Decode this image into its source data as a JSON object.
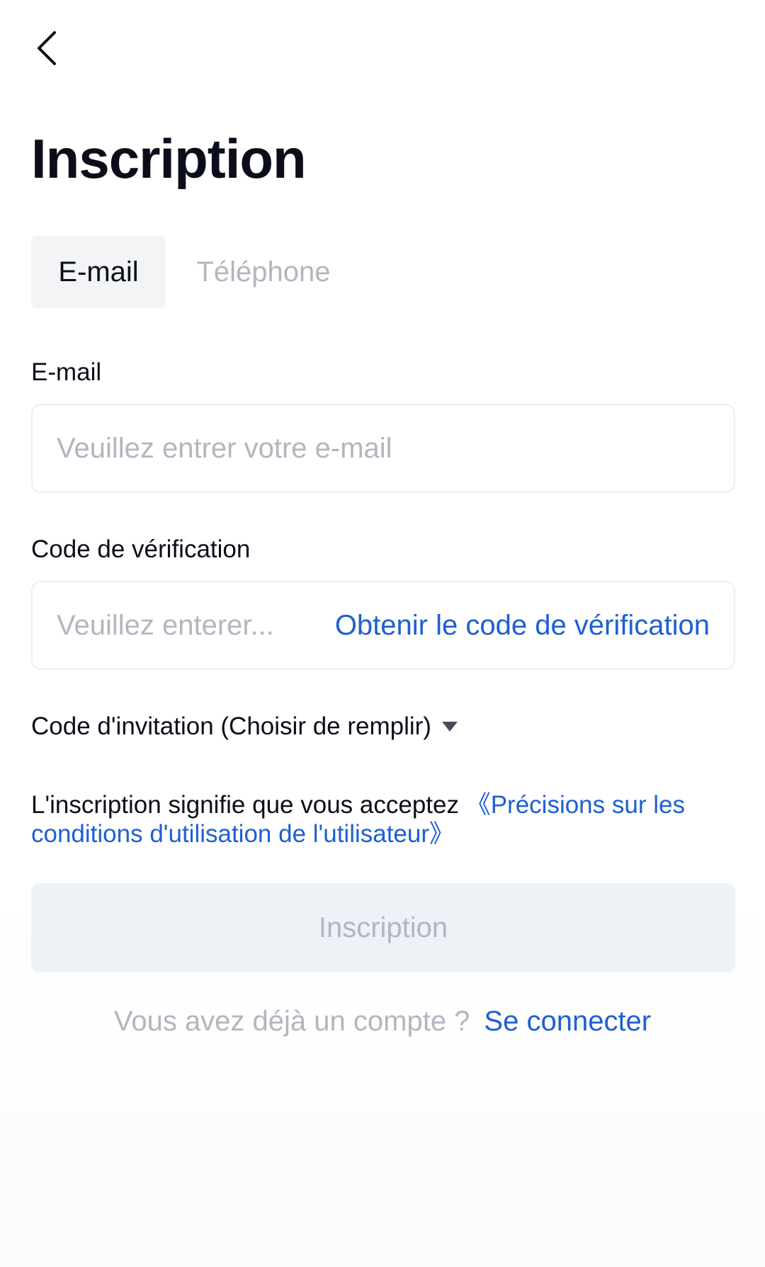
{
  "header": {
    "back_icon": "chevron-left-icon",
    "title": "Inscription"
  },
  "tabs": [
    {
      "label": "E-mail",
      "active": true
    },
    {
      "label": "Téléphone",
      "active": false
    }
  ],
  "email": {
    "label": "E-mail",
    "value": "",
    "placeholder": "Veuillez entrer votre e-mail"
  },
  "verification": {
    "label": "Code de vérification",
    "value": "",
    "placeholder": "Veuillez enterer...",
    "get_code_label": "Obtenir le code de vérification"
  },
  "invitation": {
    "label": "Code d'invitation (Choisir de remplir)",
    "icon": "caret-down-icon"
  },
  "terms": {
    "text": "L'inscription signifie que vous acceptez ",
    "link": "《Précisions sur les conditions d'utilisation de l'utilisateur》"
  },
  "submit": {
    "label": "Inscription"
  },
  "login": {
    "question": "Vous avez déjà un compte ?",
    "link": "Se connecter"
  },
  "colors": {
    "accent": "#1f5fd1",
    "text": "#0b0e1a",
    "muted": "#b3b6bf",
    "button_disabled_bg": "#eef1f6"
  }
}
